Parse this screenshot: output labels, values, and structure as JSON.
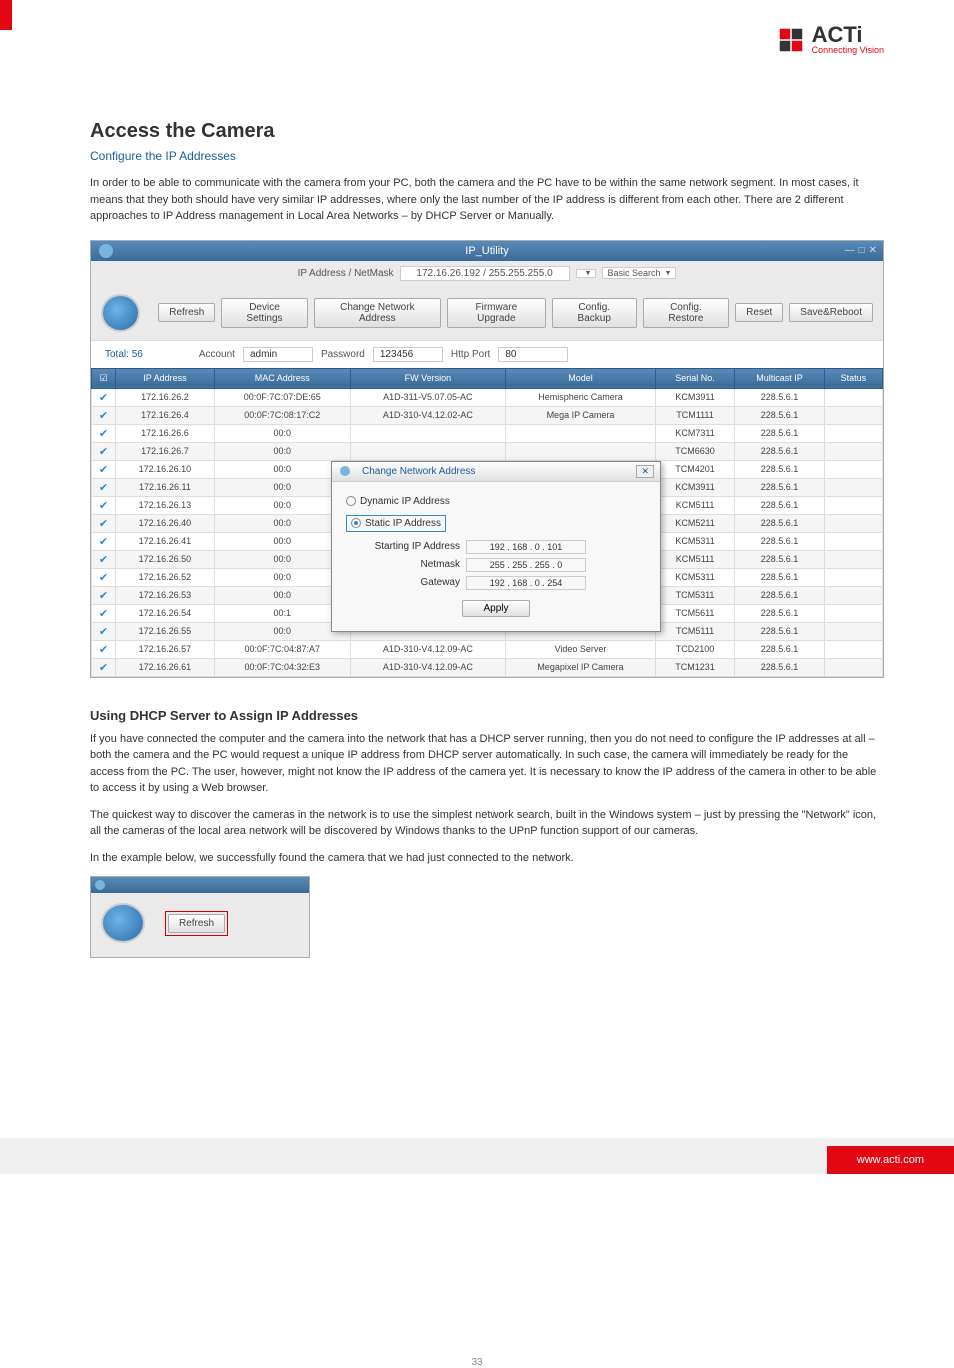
{
  "header": {
    "brand": "ACTi",
    "tagline": "Connecting Vision"
  },
  "section": {
    "title": "Access the Camera",
    "subtitle": "Configure the IP Addresses",
    "p1": "In order to be able to communicate with the camera from your PC, both the camera and the PC have to be within the same network segment. In most cases, it means that they both should have very similar IP addresses, where only the last number of the IP address is different from each other. There are 2 different approaches to IP Address management in Local Area Networks – by DHCP Server or Manually."
  },
  "dhcp": {
    "heading": "Using DHCP Server to Assign IP Addresses",
    "p1": "If you have connected the computer and the camera into the network that has a DHCP server running, then you do not need to configure the IP addresses at all – both the camera and the PC would request a unique IP address from DHCP server automatically. In such case, the camera will immediately be ready for the access from the PC. The user, however, might not know the IP address of the camera yet. It is necessary to know the IP address of the camera in other to be able to access it by using a Web browser.",
    "p2_a": "The quickest way to discover the cameras in the network is to use the simplest network search, built in the Windows system – just by pressing the \"Network\" icon, all the cameras of the local area network will be discovered by Windows thanks to the UPnP function support of our cameras.",
    "p2_b": "In the example below, we successfully found the camera that we had just connected to the network."
  },
  "app": {
    "window_title": "IP_Utility",
    "search_label": "IP Address / NetMask",
    "search_value": "172.16.26.192 / 255.255.255.0",
    "search_type": "Basic Search",
    "total_label": "Total:",
    "total_value": "56",
    "toolbar": {
      "refresh": "Refresh",
      "device_settings": "Device Settings",
      "change_addr": "Change Network Address",
      "firmware": "Firmware Upgrade",
      "config_backup": "Config. Backup",
      "config_restore": "Config. Restore",
      "reset": "Reset",
      "save_reboot": "Save&Reboot"
    },
    "params": {
      "account_label": "Account",
      "account_value": "admin",
      "password_label": "Password",
      "password_value": "123456",
      "http_label": "Http Port",
      "http_value": "80"
    },
    "columns": [
      "",
      "IP Address",
      "MAC Address",
      "FW Version",
      "Model",
      "Serial No.",
      "Multicast IP",
      "Status"
    ],
    "rows": [
      {
        "ip": "172.16.26.2",
        "mac": "00:0F:7C:07:DE:65",
        "fw": "A1D-311-V5.07.05-AC",
        "model": "Hemispheric Camera",
        "serial": "KCM3911",
        "multi": "228.5.6.1"
      },
      {
        "ip": "172.16.26.4",
        "mac": "00:0F:7C:08:17:C2",
        "fw": "A1D-310-V4.12.02-AC",
        "model": "Mega IP Camera",
        "serial": "TCM1111",
        "multi": "228.5.6.1"
      },
      {
        "ip": "172.16.26.6",
        "mac": "00:0",
        "fw": "",
        "model": "",
        "serial": "KCM7311",
        "multi": "228.5.6.1"
      },
      {
        "ip": "172.16.26.7",
        "mac": "00:0",
        "fw": "",
        "model": "",
        "serial": "TCM6630",
        "multi": "228.5.6.1"
      },
      {
        "ip": "172.16.26.10",
        "mac": "00:0",
        "fw": "",
        "model": "",
        "serial": "TCM4201",
        "multi": "228.5.6.1"
      },
      {
        "ip": "172.16.26.11",
        "mac": "00:0",
        "fw": "",
        "model": "",
        "serial": "KCM3911",
        "multi": "228.5.6.1"
      },
      {
        "ip": "172.16.26.13",
        "mac": "00:0",
        "fw": "",
        "model": "",
        "serial": "KCM5111",
        "multi": "228.5.6.1"
      },
      {
        "ip": "172.16.26.40",
        "mac": "00:0",
        "fw": "",
        "model": "",
        "serial": "KCM5211",
        "multi": "228.5.6.1"
      },
      {
        "ip": "172.16.26.41",
        "mac": "00:0",
        "fw": "",
        "model": "",
        "serial": "KCM5311",
        "multi": "228.5.6.1"
      },
      {
        "ip": "172.16.26.50",
        "mac": "00:0",
        "fw": "",
        "model": "",
        "serial": "KCM5111",
        "multi": "228.5.6.1"
      },
      {
        "ip": "172.16.26.52",
        "mac": "00:0",
        "fw": "",
        "model": "",
        "serial": "KCM5311",
        "multi": "228.5.6.1"
      },
      {
        "ip": "172.16.26.53",
        "mac": "00:0",
        "fw": "",
        "model": "",
        "serial": "TCM5311",
        "multi": "228.5.6.1"
      },
      {
        "ip": "172.16.26.54",
        "mac": "00:1",
        "fw": "",
        "model": "",
        "serial": "TCM5611",
        "multi": "228.5.6.1"
      },
      {
        "ip": "172.16.26.55",
        "mac": "00:0",
        "fw": "",
        "model": "",
        "serial": "TCM5111",
        "multi": "228.5.6.1"
      },
      {
        "ip": "172.16.26.57",
        "mac": "00:0F:7C:04:87:A7",
        "fw": "A1D-310-V4.12.09-AC",
        "model": "Video Server",
        "serial": "TCD2100",
        "multi": "228.5.6.1"
      },
      {
        "ip": "172.16.26.61",
        "mac": "00:0F:7C:04:32:E3",
        "fw": "A1D-310-V4.12.09-AC",
        "model": "Megapixel IP Camera",
        "serial": "TCM1231",
        "multi": "228.5.6.1"
      }
    ]
  },
  "dialog": {
    "title": "Change Network Address",
    "dynamic": "Dynamic IP Address",
    "static": "Static IP Address",
    "start_label": "Starting IP Address",
    "start_value": "192 . 168 .   0  . 101",
    "netmask_label": "Netmask",
    "netmask_value": "255 . 255 . 255 .   0",
    "gateway_label": "Gateway",
    "gateway_value": "192 . 168 .   0  . 254",
    "apply": "Apply"
  },
  "small_app": {
    "refresh": "Refresh"
  },
  "footer": {
    "url": "www.acti.com",
    "page": "33"
  }
}
